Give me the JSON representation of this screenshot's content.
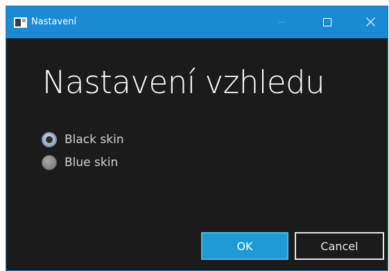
{
  "window": {
    "title": "Nastavení",
    "accent": "#1a8ad4",
    "background": "#1b1b1b",
    "app_icon": "window-icon",
    "controls": {
      "minimize_icon": "minimize-icon",
      "maximize_icon": "maximize-icon",
      "close_icon": "close-icon"
    }
  },
  "main": {
    "heading": "Nastavení vzhledu",
    "options": [
      {
        "label": "Black skin",
        "checked": true
      },
      {
        "label": "Blue skin",
        "checked": false
      }
    ]
  },
  "buttons": {
    "ok": "OK",
    "cancel": "Cancel"
  }
}
